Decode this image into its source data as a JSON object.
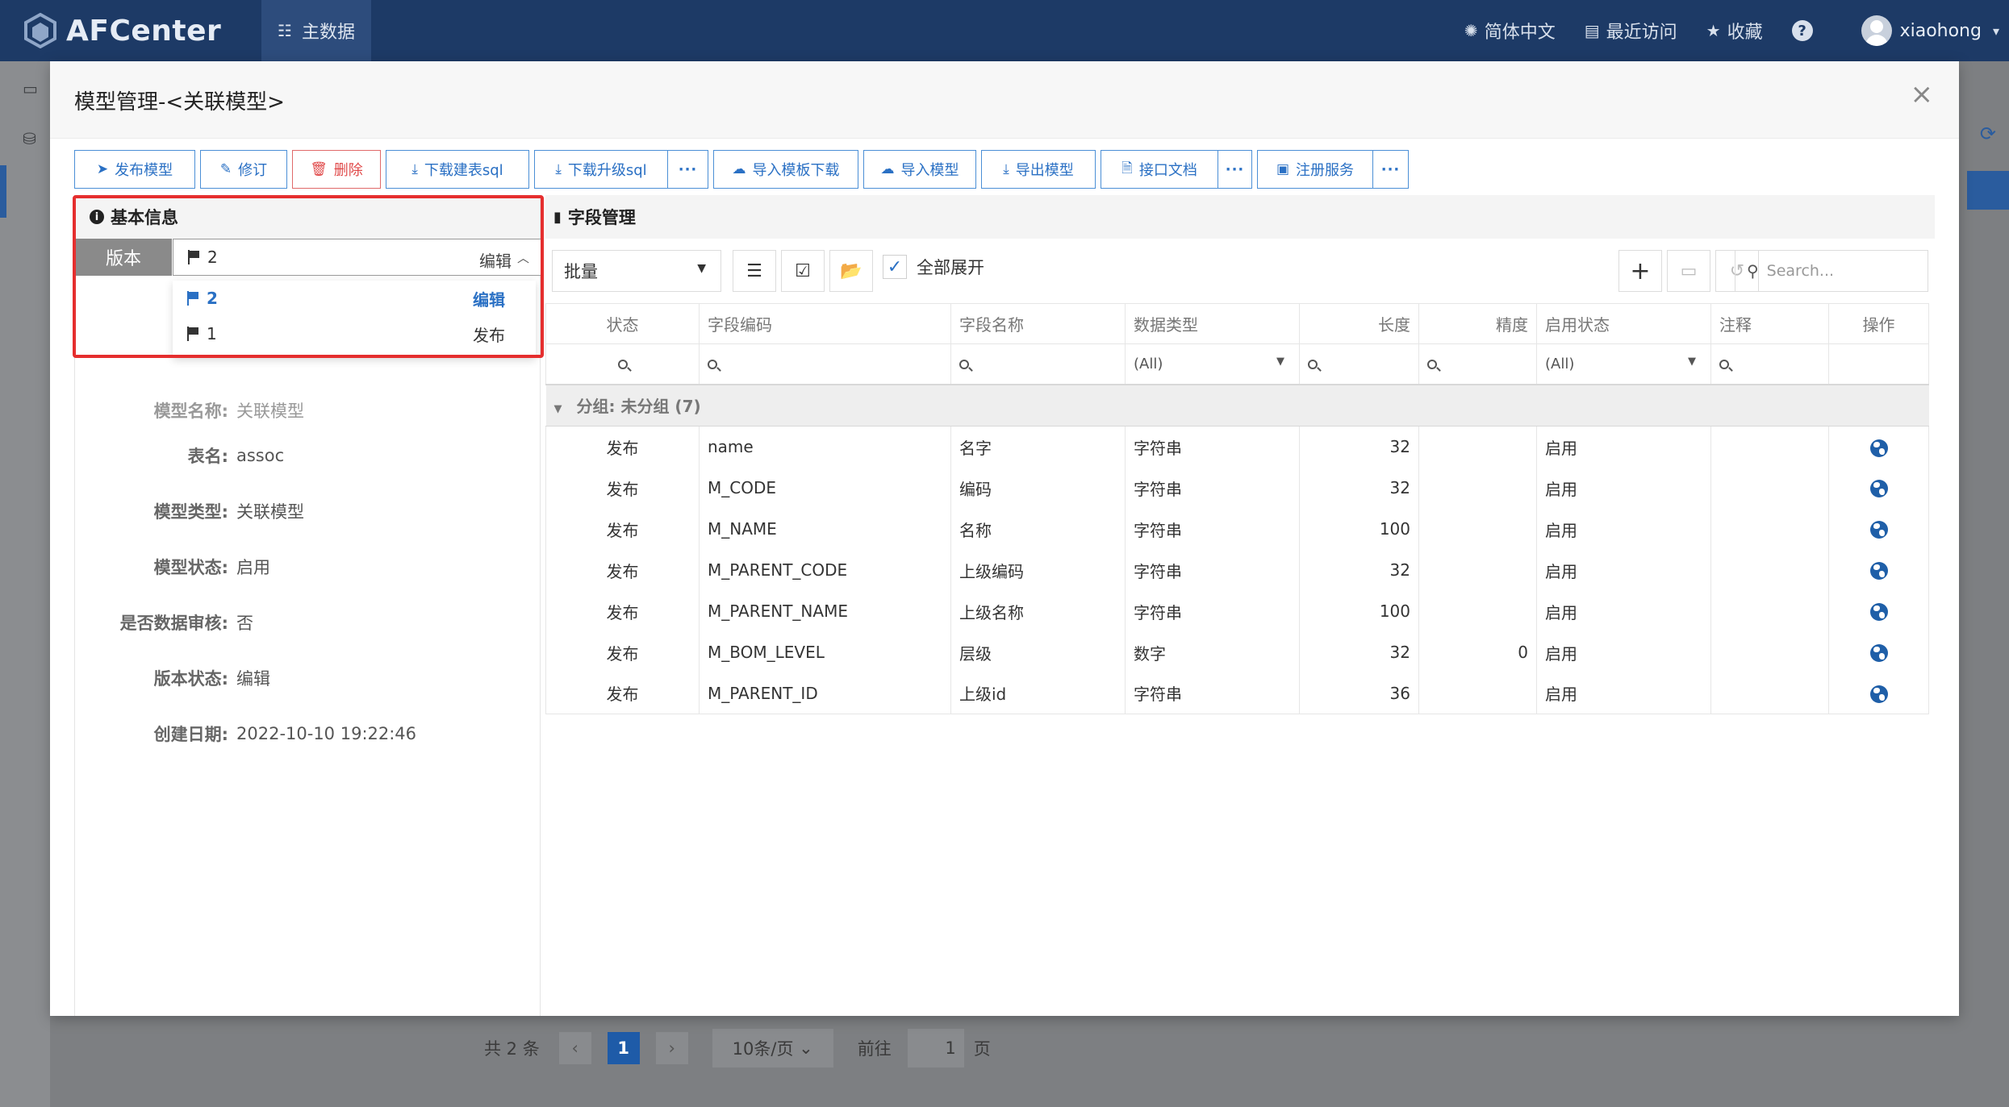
{
  "app": {
    "title": "AFCenter"
  },
  "nav": {
    "active_label": "主数据"
  },
  "top_right": {
    "language": "简体中文",
    "recent": "最近访问",
    "favorites": "收藏",
    "help": "?",
    "username": "xiaohong"
  },
  "modal": {
    "title": "模型管理-<关联模型>",
    "close": "×"
  },
  "toolbar": {
    "publish": "发布模型",
    "revise": "修订",
    "delete": "删除",
    "download_create_sql": "下载建表sql",
    "download_upgrade_sql": "下载升级sql",
    "more": "···",
    "import_template": "导入模板下载",
    "import_model": "导入模型",
    "export_model": "导出模型",
    "api_doc": "接口文档",
    "register_service": "注册服务"
  },
  "basic_info": {
    "header": "基本信息",
    "version_label": "版本",
    "version_selected": {
      "value": "2",
      "status": "编辑"
    },
    "version_options": [
      {
        "value": "2",
        "status": "编辑"
      },
      {
        "value": "1",
        "status": "发布"
      }
    ],
    "fields": [
      {
        "label": "模型名称:",
        "value": "关联模型"
      },
      {
        "label": "表名:",
        "value": "assoc"
      },
      {
        "label": "模型类型:",
        "value": "关联模型"
      },
      {
        "label": "模型状态:",
        "value": "启用"
      },
      {
        "label": "是否数据审核:",
        "value": "否"
      },
      {
        "label": "版本状态:",
        "value": "编辑"
      },
      {
        "label": "创建日期:",
        "value": "2022-10-10 19:22:46"
      }
    ]
  },
  "field_mgmt": {
    "header": "字段管理",
    "batch": "批量",
    "expand_all": "全部展开",
    "search_placeholder": "Search...",
    "columns": [
      "状态",
      "字段编码",
      "字段名称",
      "数据类型",
      "长度",
      "精度",
      "启用状态",
      "注释",
      "操作"
    ],
    "filter_all": "(All)",
    "group_label": "分组: 未分组 (7)",
    "rows": [
      {
        "status": "发布",
        "code": "name",
        "name": "名字",
        "type": "字符串",
        "length": "32",
        "precision": "",
        "enabled": "启用",
        "comment": ""
      },
      {
        "status": "发布",
        "code": "M_CODE",
        "name": "编码",
        "type": "字符串",
        "length": "32",
        "precision": "",
        "enabled": "启用",
        "comment": ""
      },
      {
        "status": "发布",
        "code": "M_NAME",
        "name": "名称",
        "type": "字符串",
        "length": "100",
        "precision": "",
        "enabled": "启用",
        "comment": ""
      },
      {
        "status": "发布",
        "code": "M_PARENT_CODE",
        "name": "上级编码",
        "type": "字符串",
        "length": "32",
        "precision": "",
        "enabled": "启用",
        "comment": ""
      },
      {
        "status": "发布",
        "code": "M_PARENT_NAME",
        "name": "上级名称",
        "type": "字符串",
        "length": "100",
        "precision": "",
        "enabled": "启用",
        "comment": ""
      },
      {
        "status": "发布",
        "code": "M_BOM_LEVEL",
        "name": "层级",
        "type": "数字",
        "length": "32",
        "precision": "0",
        "enabled": "启用",
        "comment": ""
      },
      {
        "status": "发布",
        "code": "M_PARENT_ID",
        "name": "上级id",
        "type": "字符串",
        "length": "36",
        "precision": "",
        "enabled": "启用",
        "comment": ""
      }
    ]
  },
  "background_pager": {
    "total": "共 2 条",
    "prev": "‹",
    "page": "1",
    "next": "›",
    "page_size": "10条/页",
    "goto_label": "前往",
    "goto_value": "1",
    "page_suffix": "页"
  }
}
